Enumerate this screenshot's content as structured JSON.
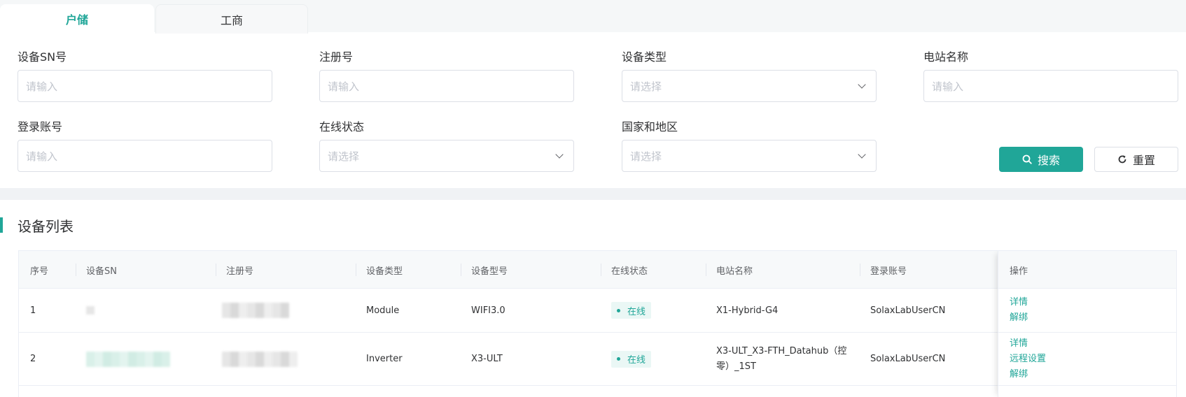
{
  "tabs": {
    "residential": "户储",
    "commercial": "工商"
  },
  "filters": {
    "sn": {
      "label": "设备SN号",
      "placeholder": "请输入"
    },
    "reg_no": {
      "label": "注册号",
      "placeholder": "请输入"
    },
    "device_type": {
      "label": "设备类型",
      "placeholder": "请选择"
    },
    "station_name": {
      "label": "电站名称",
      "placeholder": "请输入"
    },
    "account": {
      "label": "登录账号",
      "placeholder": "请输入"
    },
    "online_status": {
      "label": "在线状态",
      "placeholder": "请选择"
    },
    "country": {
      "label": "国家和地区",
      "placeholder": "请选择"
    }
  },
  "buttons": {
    "search": "搜索",
    "reset": "重置"
  },
  "list": {
    "title": "设备列表",
    "columns": [
      "序号",
      "设备SN",
      "注册号",
      "设备类型",
      "设备型号",
      "在线状态",
      "电站名称",
      "登录账号",
      "操作"
    ],
    "rows": [
      {
        "index": "1",
        "type": "Module",
        "model": "WIFI3.0",
        "status": "在线",
        "station_name": "X1-Hybrid-G4",
        "account": "SolaxLabUserCN",
        "actions": [
          "详情",
          "解绑"
        ]
      },
      {
        "index": "2",
        "type": "Inverter",
        "model": "X3-ULT",
        "status": "在线",
        "station_name": "X3-ULT_X3-FTH_Datahub（控零）_1ST",
        "account": "SolaxLabUserCN",
        "actions": [
          "详情",
          "远程设置",
          "解绑"
        ]
      }
    ]
  },
  "colors": {
    "accent": "#20a698",
    "status_bg": "#eaf7f5",
    "page_bg": "#f0f2f5"
  }
}
